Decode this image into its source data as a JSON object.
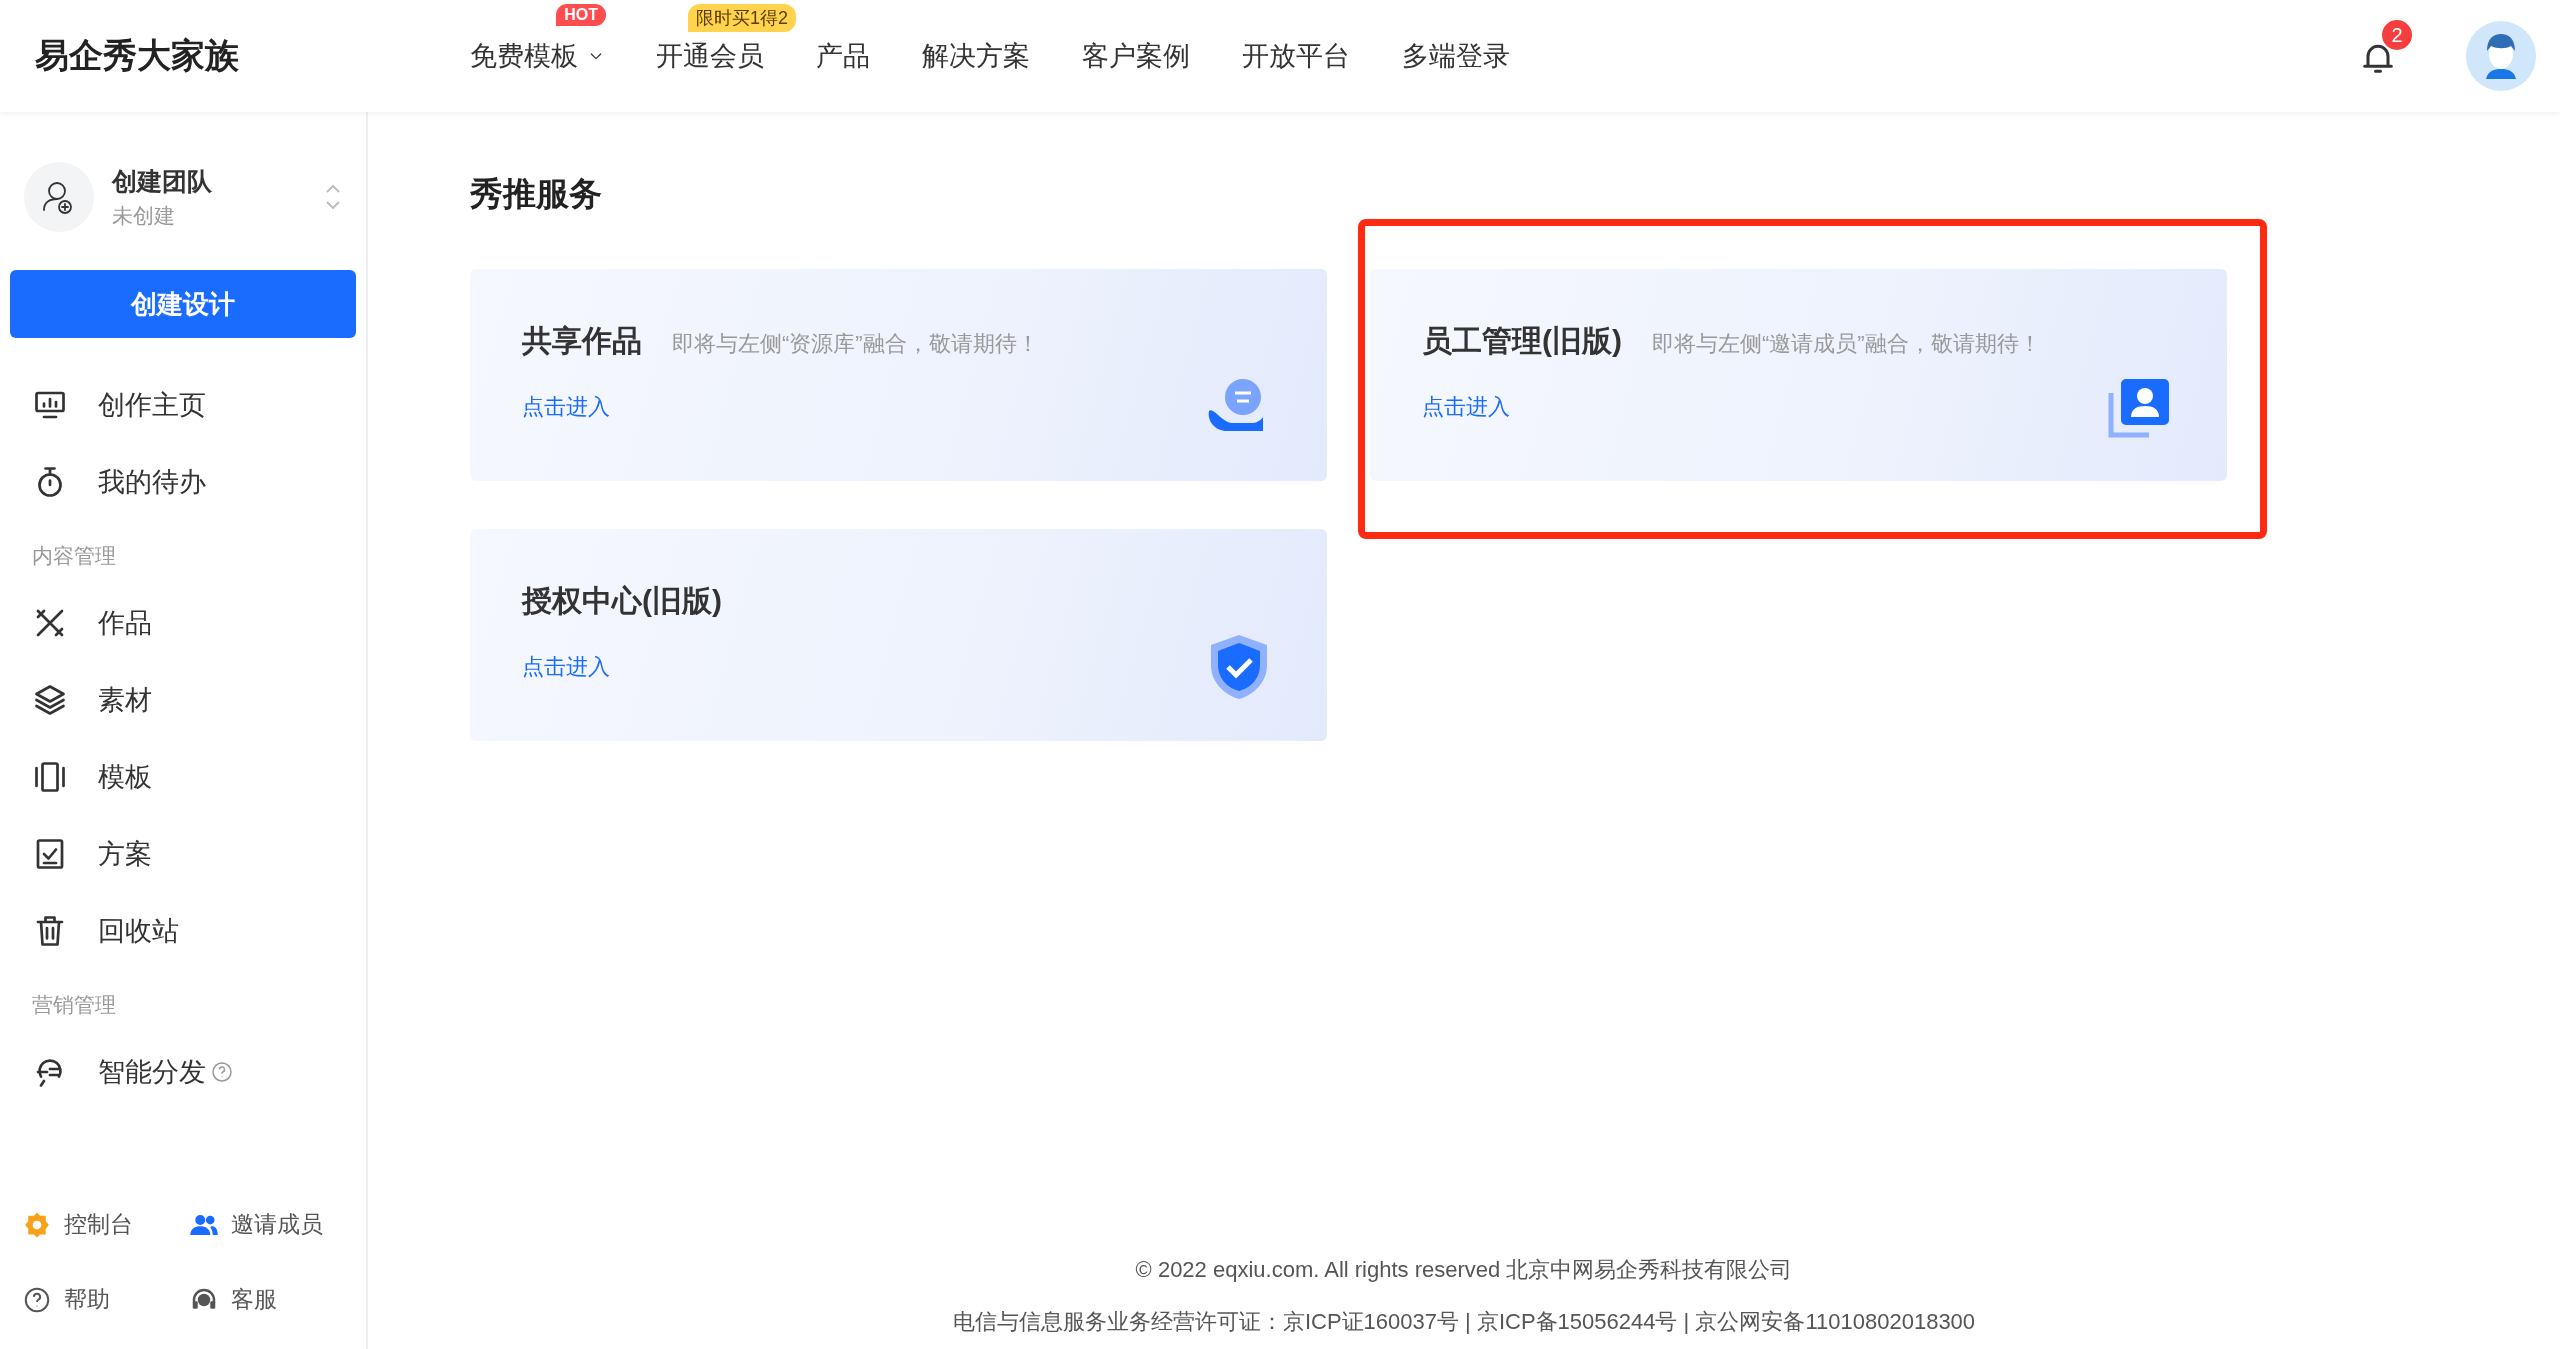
{
  "header": {
    "logo": "易企秀大家族",
    "nav": [
      {
        "label": "免费模板",
        "dropdown": true,
        "badge": {
          "kind": "hot",
          "text": "HOT"
        }
      },
      {
        "label": "开通会员",
        "dropdown": false,
        "badge": {
          "kind": "promo",
          "text": "限时买1得2"
        }
      },
      {
        "label": "产品",
        "dropdown": false
      },
      {
        "label": "解决方案",
        "dropdown": false
      },
      {
        "label": "客户案例",
        "dropdown": false
      },
      {
        "label": "开放平台",
        "dropdown": false
      },
      {
        "label": "多端登录",
        "dropdown": false
      }
    ],
    "notification_count": "2"
  },
  "sidebar": {
    "team": {
      "name": "创建团队",
      "status": "未创建"
    },
    "create_button": "创建设计",
    "sections": [
      {
        "items": [
          {
            "label": "创作主页",
            "help": false
          },
          {
            "label": "我的待办",
            "help": false
          }
        ]
      },
      {
        "label": "内容管理",
        "items": [
          {
            "label": "作品",
            "help": false
          },
          {
            "label": "素材",
            "help": false
          },
          {
            "label": "模板",
            "help": false
          },
          {
            "label": "方案",
            "help": false
          },
          {
            "label": "回收站",
            "help": false
          }
        ]
      },
      {
        "label": "营销管理",
        "items": [
          {
            "label": "智能分发",
            "help": true
          }
        ]
      }
    ],
    "bottom_links": [
      {
        "label": "控制台"
      },
      {
        "label": "邀请成员"
      },
      {
        "label": "帮助"
      },
      {
        "label": "客服"
      }
    ]
  },
  "main": {
    "title": "秀推服务",
    "cards": [
      {
        "title": "共享作品",
        "note": "即将与左侧“资源库”融合，敬请期待！",
        "link": "点击进入",
        "highlighted": false
      },
      {
        "title": "员工管理(旧版)",
        "note": "即将与左侧“邀请成员”融合，敬请期待！",
        "link": "点击进入",
        "highlighted": true
      },
      {
        "title": "授权中心(旧版)",
        "link": "点击进入",
        "highlighted": false
      }
    ]
  },
  "footer": [
    "© 2022 eqxiu.com. All rights reserved 北京中网易企秀科技有限公司",
    "电信与信息服务业务经营许可证：京ICP证160037号 | 京ICP备15056244号 | 京公网安备11010802018300"
  ]
}
